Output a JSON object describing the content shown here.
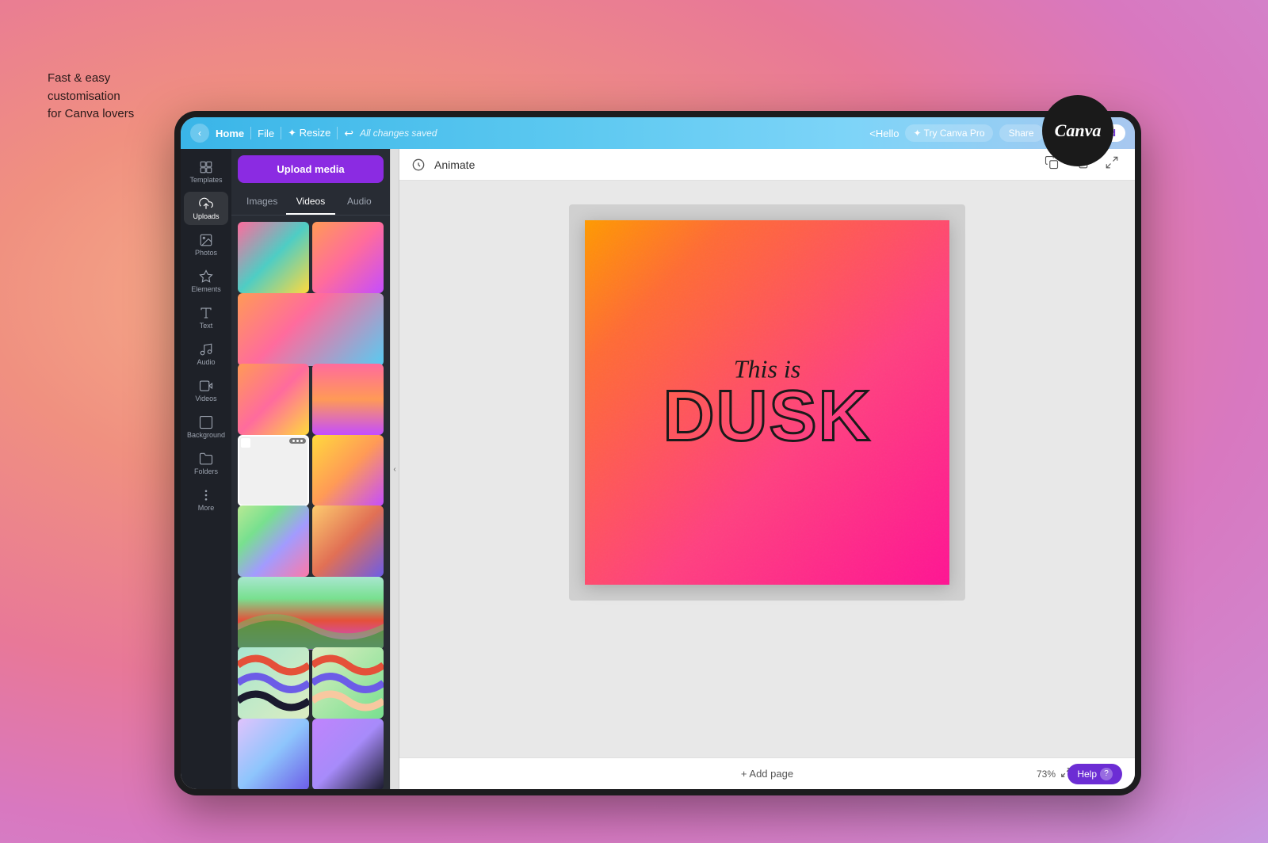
{
  "tagline": {
    "line1": "Fast & easy",
    "line2": "customisation",
    "line3": "for Canva lovers"
  },
  "canva_logo": "Canva",
  "nav": {
    "back_label": "‹",
    "home_label": "Home",
    "file_label": "File",
    "resize_label": "✦ Resize",
    "undo_label": "↩",
    "saved_label": "All changes saved",
    "hello_label": "<Hello",
    "try_pro_label": "✦ Try Canva Pro",
    "share_label": "Share",
    "download_label": "Download",
    "download_icon": "⬇"
  },
  "sidebar": {
    "items": [
      {
        "label": "Templates",
        "icon": "⊞"
      },
      {
        "label": "Uploads",
        "icon": "⬆",
        "active": true
      },
      {
        "label": "Photos",
        "icon": "🖼"
      },
      {
        "label": "Elements",
        "icon": "✦✦"
      },
      {
        "label": "Text",
        "icon": "T"
      },
      {
        "label": "Audio",
        "icon": "♪"
      },
      {
        "label": "Videos",
        "icon": "▶"
      },
      {
        "label": "Background",
        "icon": "⬜"
      },
      {
        "label": "Folders",
        "icon": "📁"
      },
      {
        "label": "More",
        "icon": "•••"
      }
    ]
  },
  "media_panel": {
    "upload_btn_label": "Upload media",
    "tabs": [
      {
        "label": "Images"
      },
      {
        "label": "Videos",
        "active": true
      },
      {
        "label": "Audio"
      }
    ]
  },
  "canvas": {
    "animate_label": "Animate",
    "design_text_this_is": "This is",
    "design_text_dusk": "DUSK",
    "add_page_label": "+ Add page",
    "zoom_value": "73%"
  },
  "help": {
    "label": "Help",
    "icon": "?"
  }
}
